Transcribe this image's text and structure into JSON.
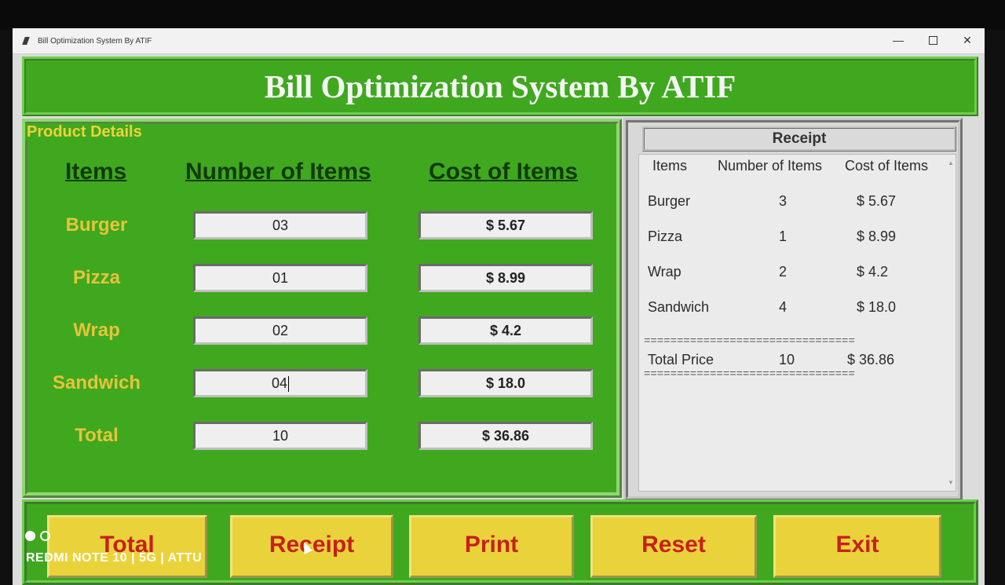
{
  "window": {
    "title": "Bill Optimization System By ATIF",
    "controls": {
      "minimize": "—",
      "close": "✕"
    }
  },
  "banner": {
    "heading": "Bill Optimization System By ATIF"
  },
  "product_details": {
    "legend": "Product Details",
    "headers": {
      "items": "Items",
      "number": "Number of Items",
      "cost": "Cost of Items"
    },
    "rows": [
      {
        "label": "Burger",
        "quantity": "03",
        "cost": "$ 5.67"
      },
      {
        "label": "Pizza",
        "quantity": "01",
        "cost": "$ 8.99"
      },
      {
        "label": "Wrap",
        "quantity": "02",
        "cost": "$ 4.2"
      },
      {
        "label": "Sandwich",
        "quantity": "04",
        "cost": "$ 18.0"
      },
      {
        "label": "Total",
        "quantity": "10",
        "cost": "$ 36.86"
      }
    ]
  },
  "receipt": {
    "title": "Receipt",
    "headers": {
      "items": "Items",
      "number": "Number of Items",
      "cost": "Cost of Items"
    },
    "lines": [
      {
        "item": "Burger",
        "qty": "3",
        "cost": "$ 5.67"
      },
      {
        "item": "Pizza",
        "qty": "1",
        "cost": "$ 8.99"
      },
      {
        "item": "Wrap",
        "qty": "2",
        "cost": "$ 4.2"
      },
      {
        "item": "Sandwich",
        "qty": "4",
        "cost": "$ 18.0"
      }
    ],
    "separator": "================================",
    "total": {
      "label": "Total Price",
      "qty": "10",
      "cost": "$ 36.86"
    }
  },
  "buttons": {
    "total": "Total",
    "receipt": "Receipt",
    "print": "Print",
    "reset": "Reset",
    "exit": "Exit"
  },
  "overlay": {
    "watermark": "REDMI NOTE 10 | 5G | ATTU"
  },
  "colors": {
    "panel_green": "#3fa81f",
    "heading_dark_green": "#143a09",
    "label_yellow": "#e6c43a",
    "button_yellow": "#ead33a",
    "button_text_red": "#c8201a"
  }
}
